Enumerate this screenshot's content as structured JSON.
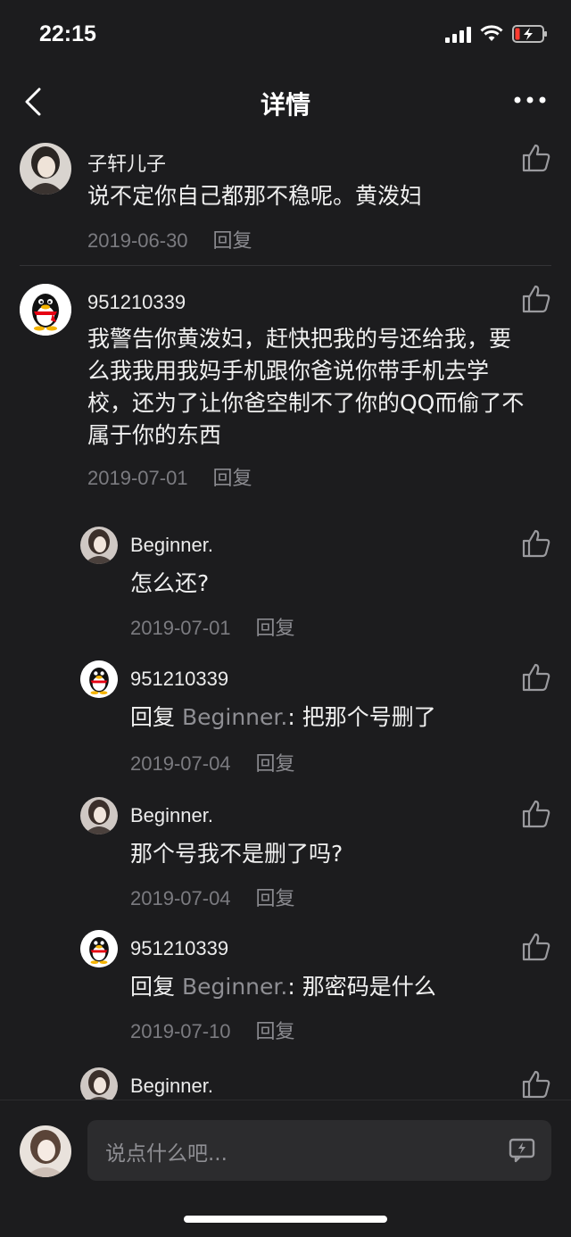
{
  "status_bar": {
    "time": "22:15"
  },
  "nav": {
    "title": "详情"
  },
  "comments": [
    {
      "user": "子轩儿子",
      "text": "说不定你自己都那不稳呢。黄泼妇",
      "date": "2019-06-30",
      "reply_label": "回复",
      "avatar": "girl-photo"
    },
    {
      "user": "951210339",
      "text": "我警告你黄泼妇，赶快把我的号还给我，要么我我用我妈手机跟你爸说你带手机去学校，还为了让你爸空制不了你的QQ而偷了不属于你的东西",
      "date": "2019-07-01",
      "reply_label": "回复",
      "avatar": "qq-penguin"
    }
  ],
  "replies": [
    {
      "user": "Beginner.",
      "text": "怎么还?",
      "date": "2019-07-01",
      "reply_label": "回复",
      "avatar": "girl-photo"
    },
    {
      "user": "951210339",
      "reply_prefix": "回复",
      "reply_to": "Beginner.",
      "text": ": 把那个号删了",
      "date": "2019-07-04",
      "reply_label": "回复",
      "avatar": "qq-penguin"
    },
    {
      "user": "Beginner.",
      "text": "那个号我不是删了吗?",
      "date": "2019-07-04",
      "reply_label": "回复",
      "avatar": "girl-photo"
    },
    {
      "user": "951210339",
      "reply_prefix": "回复",
      "reply_to": "Beginner.",
      "text": ": 那密码是什么",
      "date": "2019-07-10",
      "reply_label": "回复",
      "avatar": "qq-penguin"
    },
    {
      "user": "Beginner.",
      "avatar": "girl-photo"
    }
  ],
  "input": {
    "placeholder": "说点什么吧..."
  },
  "colors": {
    "background": "#1c1c1e",
    "meta": "#7b7b80",
    "text": "#f0f0f0"
  }
}
